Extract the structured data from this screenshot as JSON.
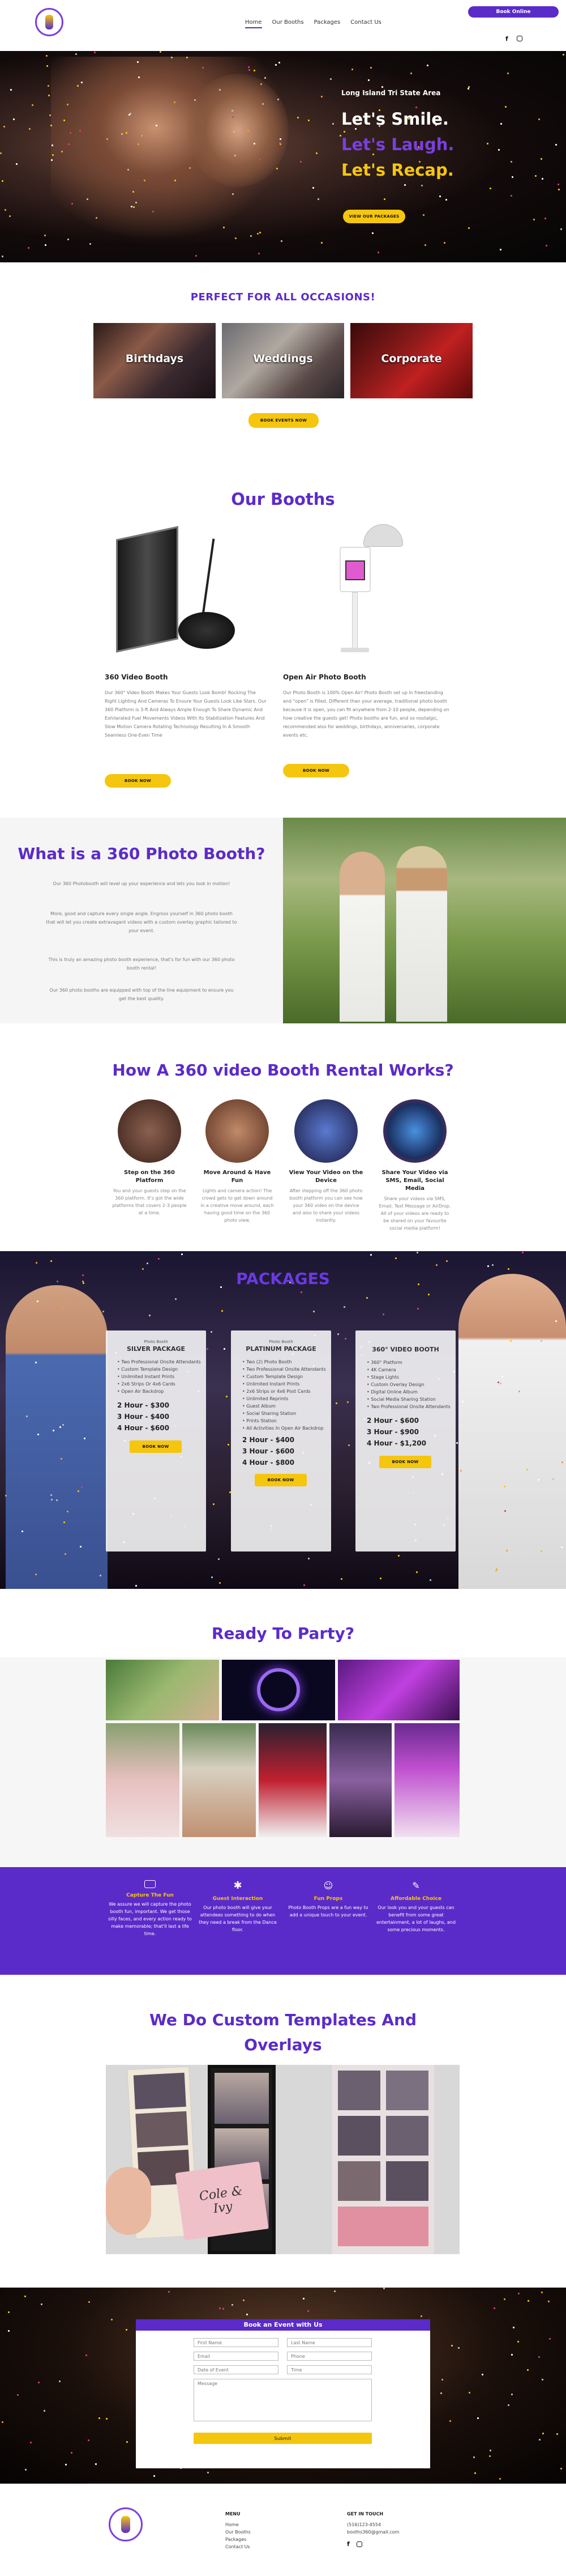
{
  "header": {
    "nav": [
      "Home",
      "Our Booths",
      "Packages",
      "Contact Us"
    ],
    "book_button": "Book Online",
    "social_icons": [
      "facebook-icon",
      "instagram-icon"
    ]
  },
  "hero": {
    "kicker": "Long Island Tri State Area",
    "line1": "Let's Smile.",
    "line2": "Let's Laugh.",
    "line3": "Let's Recap.",
    "cta": "VIEW OUR PACKAGES"
  },
  "occasions": {
    "title": "PERFECT FOR ALL OCCASIONS!",
    "cards": [
      "Birthdays",
      "Weddings",
      "Corporate"
    ],
    "cta": "BOOK EVENTS NOW"
  },
  "booths": {
    "title": "Our Booths",
    "items": [
      {
        "name": "360 Video Booth",
        "desc": "Our 360° Video Booth Makes Your Guests Look Bomb! Rocking The Right Lighting And Cameras To Ensure Your Guests Look Like Stars. Our 360 Platform is 3-ft And Always Ample Enough To Share Dynamic And Exhilarated Fuel Movements Videos With Its Stabilization Features And Slow Motion Camera Rotating Technology Resulting In A Smooth Seamless One-Even Time",
        "cta": "BOOK NOW"
      },
      {
        "name": "Open Air Photo Booth",
        "desc": "Our Photo Booth is 100% Open Air! Photo Booth set up in freestanding and \"open\" is filled. Different than your average, traditional photo booth because it is open, you can fit anywhere from 2-10 people, depending on how creative the guests get! Photo booths are fun, and so nostalgic, recommended also for weddings, birthdays, anniversaries, corporate events etc.",
        "cta": "BOOK NOW"
      }
    ]
  },
  "what": {
    "title": "What is a 360 Photo Booth?",
    "paras": [
      "Our 360 Photobooth will level up your experience and lets you look in motion!",
      "More, good and capture every single angle. Engross yourself in 360 photo booth that will let you create extravagant videos with a custom overlay graphic tailored to your event.",
      "This is truly an amazing photo booth experience, that's for fun with our 360 photo booth rental!",
      "Our 360 photo booths are equipped with top of the line equipment to ensure you get the best quality."
    ]
  },
  "how": {
    "title": "How A 360 video Booth Rental Works?",
    "steps": [
      {
        "title": "Step on the 360 Platform",
        "desc": "You and your guests step on the 360 platform. It's got the wide platforms that covers 2-3 people at a time."
      },
      {
        "title": "Move Around & Have Fun",
        "desc": "Lights and camera action! The crowd gets to get down around in a creative move around, each having good time on the 360 photo view."
      },
      {
        "title": "View Your Video on the Device",
        "desc": "After stepping off the 360 photo booth platform you can see how your 360 video on the device and also to share your videos instantly."
      },
      {
        "title": "Share Your Video via SMS, Email, Social Media",
        "desc": "Share your videos via SMS, Email, Text Message or AirDrop. All of your videos are ready to be shared on your favourite social media platform!"
      }
    ]
  },
  "packages": {
    "title": "PACKAGES",
    "items": [
      {
        "kicker": "Photo Booth",
        "name": "SILVER PACKAGE",
        "features": [
          "Two Professional Onsite Attendants",
          "Custom Template Design",
          "Unlimited Instant Prints",
          "2x6 Strips Or 4x6 Cards",
          "Open Air Backdrop"
        ],
        "prices": [
          "2 Hour - $300",
          "3 Hour - $400",
          "4 Hour - $600"
        ],
        "cta": "BOOK NOW"
      },
      {
        "kicker": "Photo Booth",
        "name": "PLATINUM PACKAGE",
        "features": [
          "Two (2) Photo Booth",
          "Two Professional Onsite Attendants",
          "Custom Template Design",
          "Unlimited Instant Prints",
          "2x6 Strips or 4x6 Post Cards",
          "Unlimited Reprints",
          "Guest Album",
          "Social Sharing Station",
          "Prints Station",
          "All Activities In Open Air Backdrop"
        ],
        "prices": [
          "2 Hour - $400",
          "3 Hour - $600",
          "4 Hour - $800"
        ],
        "cta": "BOOK NOW"
      },
      {
        "kicker": "",
        "name": "360° VIDEO BOOTH",
        "features": [
          "360° Platform",
          "4K Camera",
          "Stage Lights",
          "Custom Overlay Design",
          "Digital Online Album",
          "Social Media Sharing Station",
          "Two Professional Onsite Attendants"
        ],
        "prices": [
          "2 Hour - $600",
          "3 Hour - $900",
          "4 Hour - $1,200"
        ],
        "cta": "BOOK NOW"
      }
    ]
  },
  "party": {
    "title": "Ready To Party?"
  },
  "features": [
    {
      "title": "Capture The Fun",
      "desc": "We assure we will capture the photo booth fun, important. We get those silly faces, and every action ready to make memorable; that'll last a life time."
    },
    {
      "title": "Guest Interaction",
      "desc": "Our photo booth will give your attendees something to do when they need a break from the Dance floor."
    },
    {
      "title": "Fun Props",
      "desc": "Photo Booth Props are a fun way to add a unique touch to your event."
    },
    {
      "title": "Affordable Choice",
      "desc": "Our look you and your guests can benefit from some great entertainment, a lot of laughs, and some precious moments."
    }
  ],
  "templates": {
    "title_line1": "We Do Custom Templates And",
    "title_line2": "Overlays",
    "strip_text": "Cole & Ivy"
  },
  "form": {
    "title": "Book an Event with Us",
    "fields": [
      "First Name",
      "Last Name",
      "Email",
      "Phone",
      "Date of Event",
      "Time"
    ],
    "message": "Message",
    "submit": "Submit"
  },
  "footer": {
    "menu_title": "MENU",
    "menu": [
      "Home",
      "Our Booths",
      "Packages",
      "Contact Us"
    ],
    "contact_title": "GET IN TOUCH",
    "phone": "(516)123-4554",
    "email": "booths360@gmail.com"
  },
  "colors": {
    "purple": "#5b2bc9",
    "yellow": "#f5c60e",
    "dark": "#111111"
  }
}
